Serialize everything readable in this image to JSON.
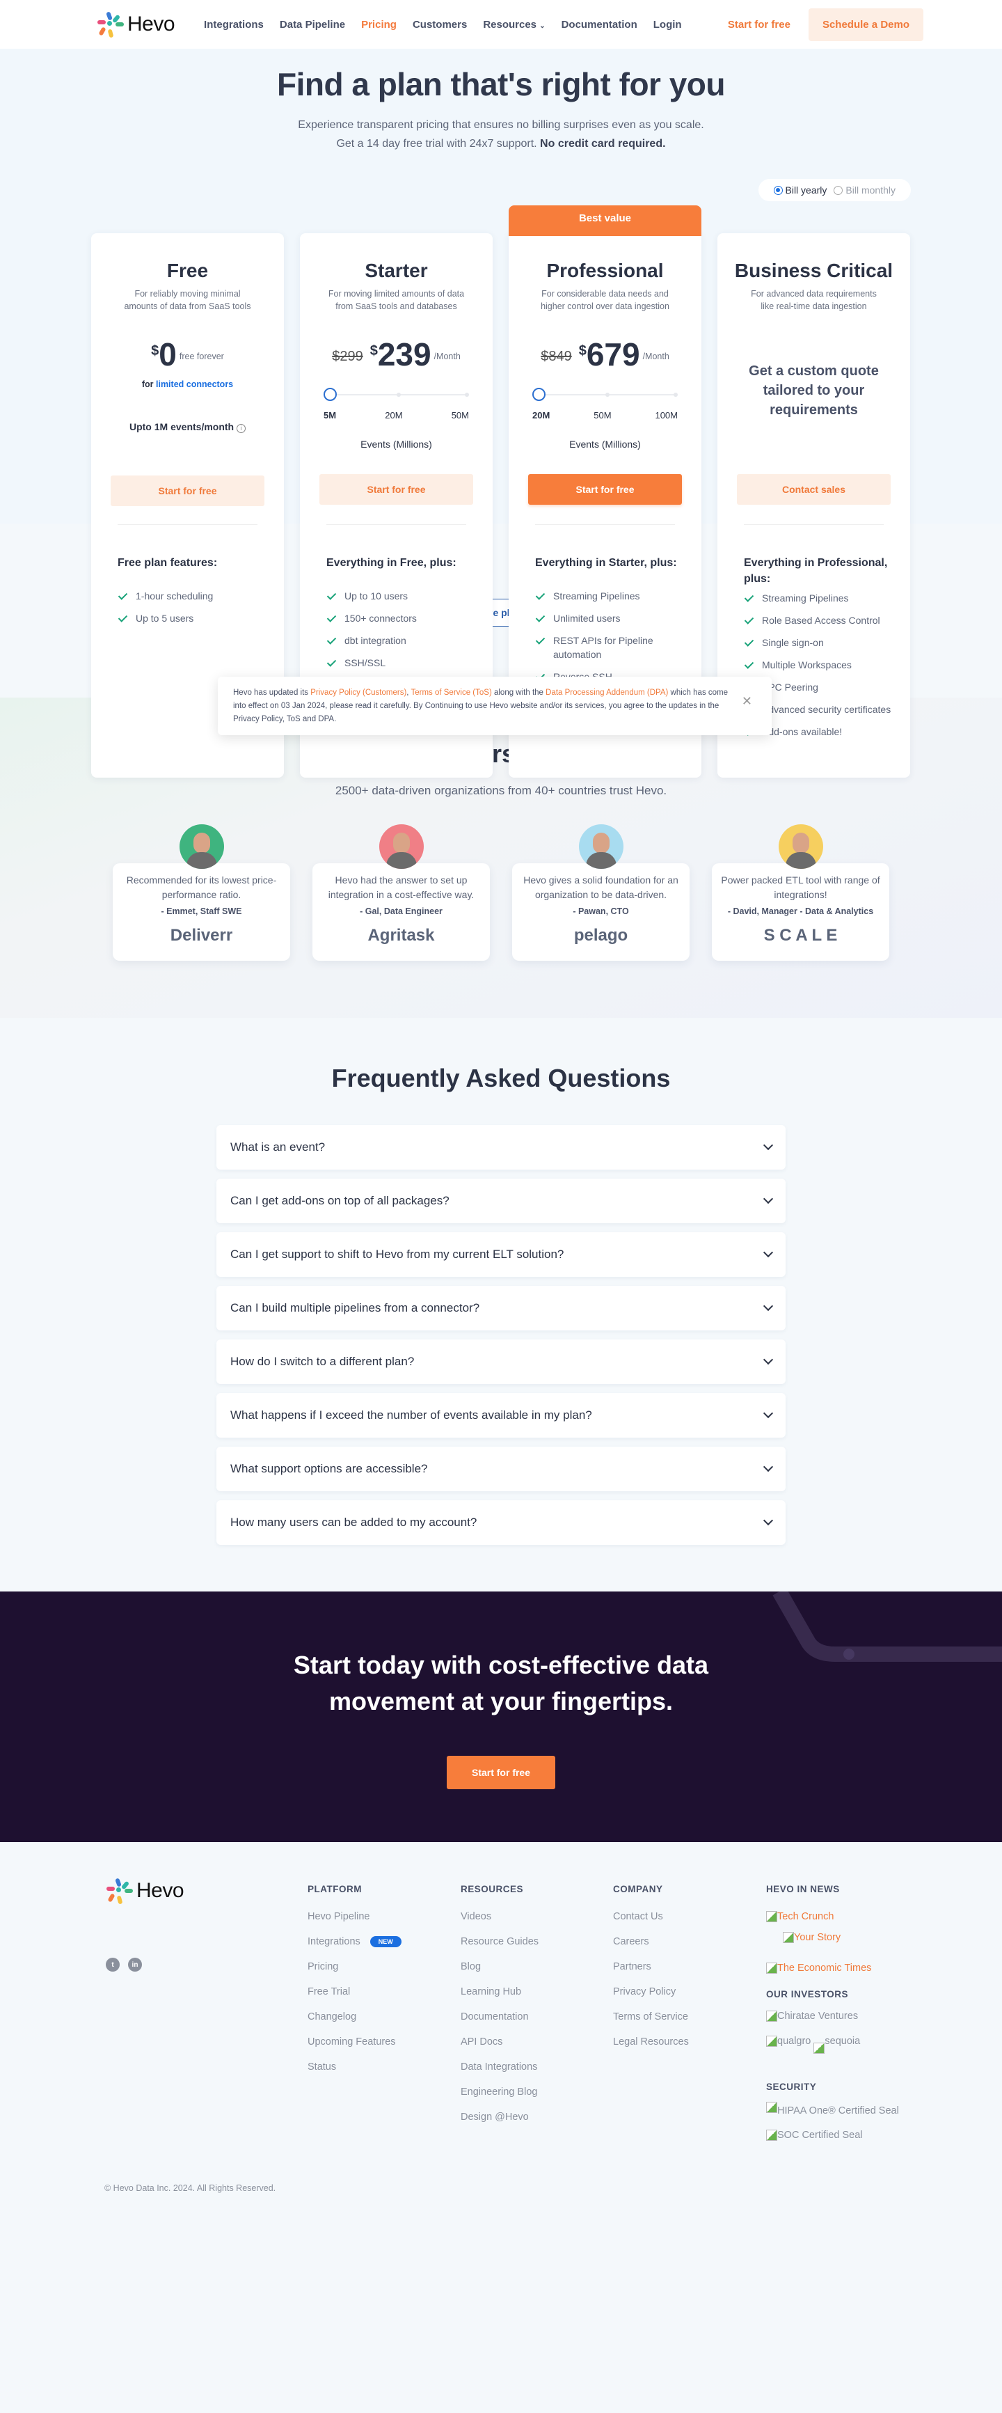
{
  "nav": {
    "brand": "Hevo",
    "links": [
      "Integrations",
      "Data Pipeline",
      "Pricing",
      "Customers",
      "Resources",
      "Documentation",
      "Login"
    ],
    "active": "Pricing",
    "start_label": "Start for free",
    "demo_label": "Schedule a Demo"
  },
  "hero": {
    "title": "Find a plan that's right for you",
    "line1": "Experience transparent pricing that ensures no billing surprises even as you scale.",
    "line2": "Get a 14 day free trial with 24x7 support.",
    "line2_bold": "No credit card required.",
    "billing": {
      "yearly": "Bill yearly",
      "monthly": "Bill monthly",
      "selected": "yearly"
    }
  },
  "plans": [
    {
      "name": "Free",
      "desc": "For reliably moving minimal amounts of data from SaaS tools",
      "currency": "$",
      "price": "0",
      "unit": "free forever",
      "sub_prefix": "for",
      "sub_link": "limited connectors",
      "events": "Upto 1M events/month",
      "cta": "Start for free",
      "features_title": "Free plan features:",
      "features": [
        "1-hour scheduling",
        "Up to 5 users"
      ]
    },
    {
      "name": "Starter",
      "desc": "For moving limited amounts of data from SaaS tools and databases",
      "old_price": "$299",
      "currency": "$",
      "price": "239",
      "unit": "/Month",
      "slider": {
        "ticks": [
          "5M",
          "20M",
          "50M"
        ],
        "selected": "5M"
      },
      "slider_label": "Events (Millions)",
      "cta": "Start for free",
      "features_title": "Everything in Free, plus:",
      "features": [
        "Up to 10 users",
        "150+ connectors",
        "dbt integration",
        "SSH/SSL"
      ]
    },
    {
      "name": "Professional",
      "badge": "Best value",
      "desc": "For considerable data needs and higher control over data ingestion",
      "old_price": "$849",
      "currency": "$",
      "price": "679",
      "unit": "/Month",
      "slider": {
        "ticks": [
          "20M",
          "50M",
          "100M"
        ],
        "selected": "20M"
      },
      "slider_label": "Events (Millions)",
      "cta": "Start for free",
      "features_title": "Everything in Starter, plus:",
      "features": [
        "Streaming Pipelines",
        "Unlimited users",
        "REST APIs for Pipeline automation",
        "Reverse SSH"
      ]
    },
    {
      "name": "Business Critical",
      "desc": "For advanced data requirements like real-time data ingestion",
      "quote": "Get a custom quote tailored to your requirements",
      "cta": "Contact sales",
      "features_title": "Everything in Professional, plus:",
      "features": [
        "Streaming Pipelines",
        "Role Based Access Control",
        "Single sign-on",
        "Multiple Workspaces",
        "VPC Peering",
        "Advanced security certificates",
        "Add-ons available!"
      ]
    }
  ],
  "cookie": {
    "t1": "Hevo has updated its ",
    "l1": "Privacy Policy (Customers)",
    "t2": ", ",
    "l2": "Terms of Service (ToS)",
    "t3": "  along with the ",
    "l3": "Data Processing Addendum (DPA)",
    "t4": " which has come into effect on 03 Jan 2024, please read it carefully. By Continuing to use Hevo website and/or its services, you agree to the updates in the Privacy Policy, ToS and DPA.",
    "close": "✕"
  },
  "compare_label": "Compare plan features",
  "customers": {
    "title": "Customers love us!",
    "subtitle": "2500+ data-driven organizations from 40+ countries trust Hevo.",
    "testimonials": [
      {
        "quote": "Recommended for its lowest price-performance ratio.",
        "who": "- Emmet, Staff SWE",
        "brand": "Deliverr",
        "color": "#3fb47f"
      },
      {
        "quote": "Hevo had the answer to set up integration in a cost-effective way.",
        "who": "- Gal, Data Engineer",
        "brand": "Agritask",
        "color": "#f07f86"
      },
      {
        "quote": "Hevo gives a solid foundation for an organization to be data-driven.",
        "who": "- Pawan, CTO",
        "brand": "pelago",
        "color": "#a8dcf0"
      },
      {
        "quote": "Power packed ETL tool with range of integrations!",
        "who": "- David, Manager - Data & Analytics",
        "brand": "S C A L E",
        "color": "#f6cf5f"
      }
    ]
  },
  "faq": {
    "title": "Frequently Asked Questions",
    "items": [
      "What is an event?",
      "Can I get add-ons on top of all packages?",
      "Can I get support to shift to Hevo from my current ELT solution?",
      "Can I build multiple pipelines from a connector?",
      "How do I switch to a different plan?",
      "What happens if I exceed the number of events available in my plan?",
      "What support options are accessible?",
      "How many users can be added to my account?"
    ]
  },
  "cta": {
    "title": "Start today with cost-effective data movement at your fingertips.",
    "button": "Start for free"
  },
  "footer": {
    "brand": "Hevo",
    "social": [
      "twitter",
      "linkedin"
    ],
    "platform": {
      "title": "PLATFORM",
      "links": [
        "Hevo Pipeline",
        "Integrations",
        "Pricing",
        "Free Trial",
        "Changelog",
        "Upcoming Features",
        "Status"
      ],
      "new_badge": "NEW"
    },
    "resources": {
      "title": "RESOURCES",
      "links": [
        "Videos",
        "Resource Guides",
        "Blog",
        "Learning Hub",
        "Documentation",
        "API Docs",
        "Data Integrations",
        "Engineering Blog",
        "Design @Hevo"
      ]
    },
    "company": {
      "title": "COMPANY",
      "links": [
        "Contact Us",
        "Careers",
        "Partners",
        "Privacy Policy",
        "Terms of Service",
        "Legal Resources"
      ]
    },
    "news": {
      "title": "HEVO IN NEWS",
      "items": [
        "Tech Crunch",
        "Your Story",
        "The Economic Times"
      ]
    },
    "investors": {
      "title": "OUR INVESTORS",
      "items": [
        "Chiratae Ventures",
        "qualgro",
        "sequoia"
      ]
    },
    "security": {
      "title": "SECURITY",
      "items": [
        "HIPAA One® Certified Seal",
        "SOC Certified Seal"
      ]
    },
    "copyright": "© Hevo Data Inc. 2024. All Rights Reserved."
  }
}
